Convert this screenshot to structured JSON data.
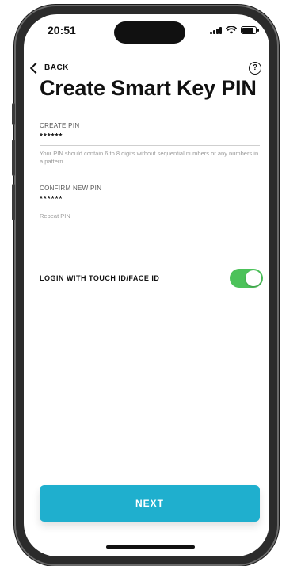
{
  "status_bar": {
    "time": "20:51"
  },
  "nav": {
    "back_label": "BACK",
    "help_icon": "question-circle-icon"
  },
  "page": {
    "title": "Create Smart Key PIN"
  },
  "create_pin": {
    "label": "CREATE PIN",
    "value": "******",
    "hint": "Your PIN should contain 6 to 8 digits without sequential numbers or any numbers in a pattern."
  },
  "confirm_pin": {
    "label": "CONFIRM NEW PIN",
    "value": "******",
    "hint": "Repeat PIN"
  },
  "touch_id": {
    "label": "LOGIN WITH TOUCH ID/FACE ID",
    "enabled": true
  },
  "next_button": {
    "label": "NEXT"
  },
  "colors": {
    "accent": "#1fafce",
    "toggle_on": "#4cc25a",
    "text": "#111111"
  }
}
